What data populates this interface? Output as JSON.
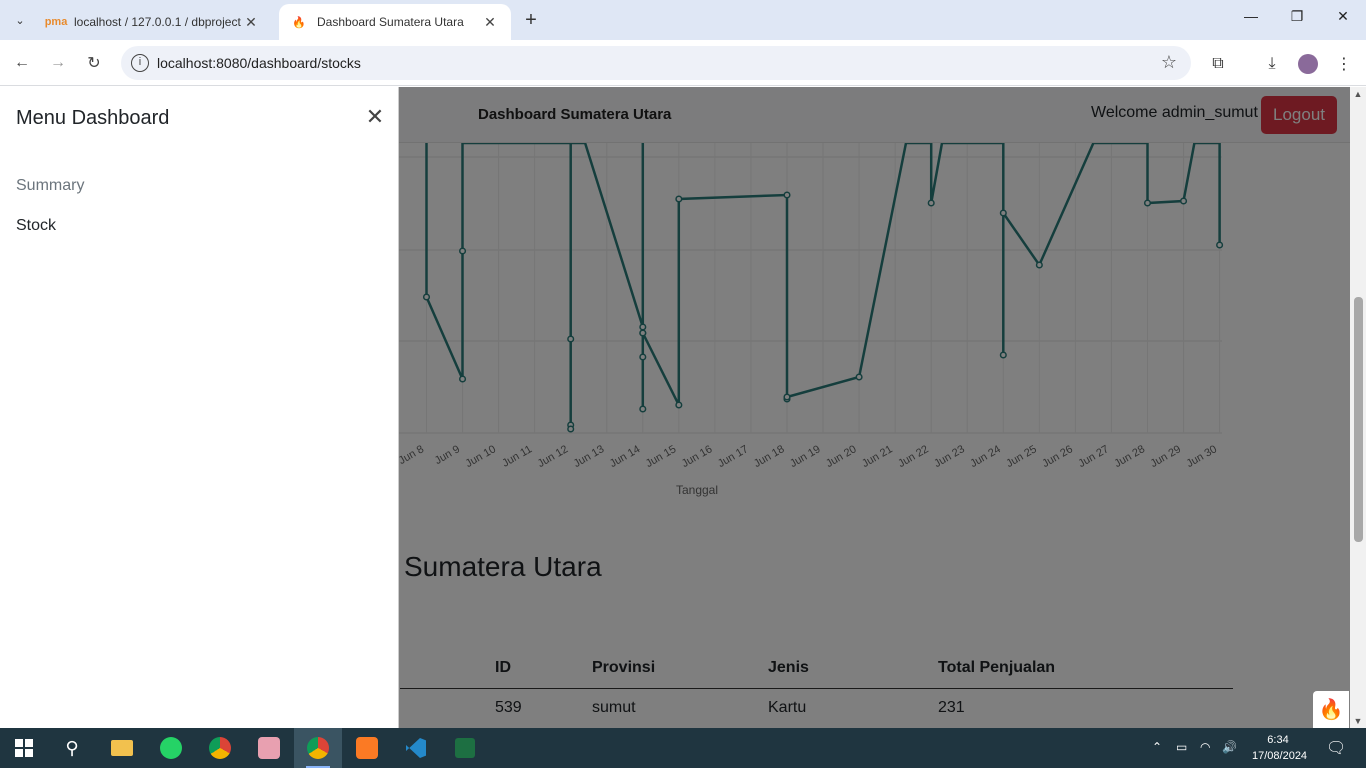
{
  "browser": {
    "tabs": [
      {
        "title": "localhost / 127.0.0.1 / dbproject",
        "favicon": "phpmyadmin-icon"
      },
      {
        "title": "Dashboard Sumatera Utara",
        "favicon": "flame-icon"
      }
    ],
    "url": "localhost:8080/dashboard/stocks"
  },
  "navbar": {
    "brand": "Dashboard Sumatera Utara",
    "welcome": "Welcome admin_sumut",
    "logout_label": "Logout"
  },
  "offcanvas": {
    "title": "Menu Dashboard",
    "items": [
      {
        "label": "Summary"
      },
      {
        "label": "Stock"
      }
    ]
  },
  "chart_data": {
    "type": "line",
    "xlabel": "Tanggal",
    "x_ticks": [
      "Jun 8",
      "Jun 9",
      "Jun 10",
      "Jun 11",
      "Jun 12",
      "Jun 13",
      "Jun 14",
      "Jun 15",
      "Jun 16",
      "Jun 17",
      "Jun 18",
      "Jun 19",
      "Jun 20",
      "Jun 21",
      "Jun 22",
      "Jun 23",
      "Jun 24",
      "Jun 25",
      "Jun 26",
      "Jun 27",
      "Jun 28",
      "Jun 29",
      "Jun 30"
    ],
    "color": "#2a7d7b",
    "series": [
      {
        "values": [
          [
            8.0,
            1.45
          ],
          [
            8.0,
            0.68
          ],
          [
            9.0,
            0.27
          ],
          [
            9.0,
            0.91
          ],
          [
            9.0,
            1.45
          ],
          [
            12.0,
            1.45
          ],
          [
            12.0,
            0.47
          ],
          [
            12.0,
            0.04
          ],
          [
            12.0,
            0.02
          ],
          [
            12.0,
            1.45
          ],
          [
            12.4,
            1.45
          ],
          [
            14.0,
            0.53
          ],
          [
            14.0,
            0.5
          ],
          [
            14.0,
            0.38
          ],
          [
            14.0,
            0.12
          ],
          [
            14.0,
            1.45
          ],
          [
            14.0,
            0.5
          ],
          [
            15.0,
            0.14
          ],
          [
            15.0,
            1.17
          ],
          [
            18.0,
            1.19
          ],
          [
            18.0,
            0.17
          ],
          [
            18.0,
            0.18
          ],
          [
            20.0,
            0.28
          ],
          [
            21.3,
            1.45
          ],
          [
            22.0,
            1.45
          ],
          [
            22.0,
            1.15
          ],
          [
            22.3,
            1.45
          ],
          [
            24.0,
            1.45
          ],
          [
            24.0,
            0.39
          ],
          [
            24.0,
            1.1
          ],
          [
            25.0,
            0.84
          ],
          [
            26.5,
            1.45
          ],
          [
            28.0,
            1.45
          ],
          [
            28.0,
            1.15
          ],
          [
            29.0,
            1.16
          ],
          [
            29.3,
            1.45
          ],
          [
            30.0,
            1.45
          ],
          [
            30.0,
            0.94
          ]
        ]
      }
    ]
  },
  "section": {
    "title": "Sumatera Utara"
  },
  "table": {
    "headers": [
      "ID",
      "Provinsi",
      "Jenis",
      "Total Penjualan"
    ],
    "rows": [
      [
        "539",
        "sumut",
        "Kartu",
        "231"
      ]
    ]
  },
  "taskbar": {
    "time": "6:34",
    "date": "17/08/2024"
  }
}
